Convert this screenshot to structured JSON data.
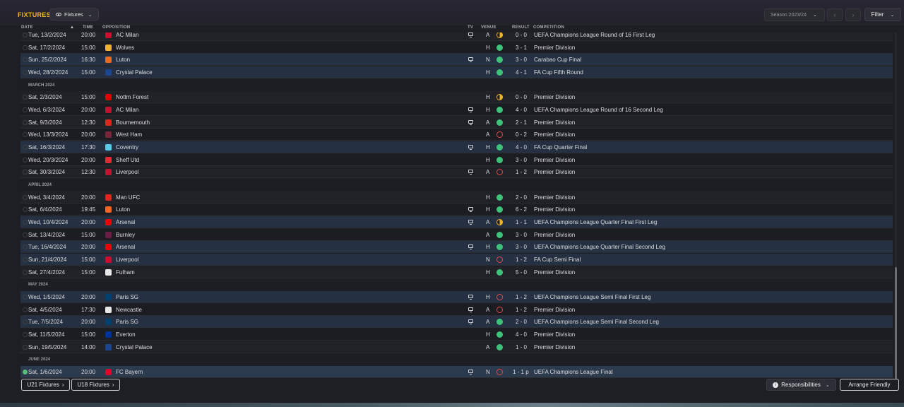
{
  "page": {
    "title": "FIXTURES",
    "view_label": "Fixtures",
    "season_label": "Season 2023/24",
    "filter_label": "Filter"
  },
  "columns": {
    "date": "DATE",
    "time": "TIME",
    "opposition": "OPPOSITION",
    "tv": "TV",
    "venue": "VENUE",
    "result": "RESULT",
    "competition": "COMPETITION"
  },
  "rows": [
    {
      "type": "fixture",
      "date": "Tue, 13/2/2024",
      "time": "20:00",
      "opp": "AC Milan",
      "tv": true,
      "venue": "A",
      "res": "d",
      "score": "0 - 0",
      "comp": "UEFA Champions League Round of 16 First Leg",
      "crest": "#c8102e",
      "hl": false
    },
    {
      "type": "fixture",
      "date": "Sat, 17/2/2024",
      "time": "15:00",
      "opp": "Wolves",
      "tv": false,
      "venue": "H",
      "res": "w",
      "score": "3 - 1",
      "comp": "Premier Division",
      "crest": "#f0b429",
      "hl": false
    },
    {
      "type": "fixture",
      "date": "Sun, 25/2/2024",
      "time": "16:30",
      "opp": "Luton",
      "tv": true,
      "venue": "N",
      "res": "w",
      "score": "3 - 0",
      "comp": "Carabao Cup Final",
      "crest": "#f26522",
      "hl": true
    },
    {
      "type": "fixture",
      "date": "Wed, 28/2/2024",
      "time": "15:00",
      "opp": "Crystal Palace",
      "tv": false,
      "venue": "H",
      "res": "w",
      "score": "4 - 1",
      "comp": "FA Cup Fifth Round",
      "crest": "#1b458f",
      "hl": true
    },
    {
      "type": "month",
      "label": "MARCH 2024"
    },
    {
      "type": "fixture",
      "date": "Sat, 2/3/2024",
      "time": "15:00",
      "opp": "Nottm Forest",
      "tv": false,
      "venue": "H",
      "res": "d",
      "score": "0 - 0",
      "comp": "Premier Division",
      "crest": "#dd0000",
      "hl": false
    },
    {
      "type": "fixture",
      "date": "Wed, 6/3/2024",
      "time": "20:00",
      "opp": "AC Milan",
      "tv": true,
      "venue": "H",
      "res": "w",
      "score": "4 - 0",
      "comp": "UEFA Champions League Round of 16 Second Leg",
      "crest": "#c8102e",
      "hl": false
    },
    {
      "type": "fixture",
      "date": "Sat, 9/3/2024",
      "time": "12:30",
      "opp": "Bournemouth",
      "tv": true,
      "venue": "A",
      "res": "w",
      "score": "2 - 1",
      "comp": "Premier Division",
      "crest": "#da291c",
      "hl": false
    },
    {
      "type": "fixture",
      "date": "Wed, 13/3/2024",
      "time": "20:00",
      "opp": "West Ham",
      "tv": false,
      "venue": "A",
      "res": "l",
      "score": "0 - 2",
      "comp": "Premier Division",
      "crest": "#7a263a",
      "hl": false
    },
    {
      "type": "fixture",
      "date": "Sat, 16/3/2024",
      "time": "17:30",
      "opp": "Coventry",
      "tv": true,
      "venue": "H",
      "res": "w",
      "score": "4 - 0",
      "comp": "FA Cup Quarter Final",
      "crest": "#59cbe8",
      "hl": true
    },
    {
      "type": "fixture",
      "date": "Wed, 20/3/2024",
      "time": "20:00",
      "opp": "Sheff Utd",
      "tv": false,
      "venue": "H",
      "res": "w",
      "score": "3 - 0",
      "comp": "Premier Division",
      "crest": "#ee2737",
      "hl": false
    },
    {
      "type": "fixture",
      "date": "Sat, 30/3/2024",
      "time": "12:30",
      "opp": "Liverpool",
      "tv": true,
      "venue": "A",
      "res": "l",
      "score": "1 - 2",
      "comp": "Premier Division",
      "crest": "#c8102e",
      "hl": false
    },
    {
      "type": "month",
      "label": "APRIL 2024"
    },
    {
      "type": "fixture",
      "date": "Wed, 3/4/2024",
      "time": "20:00",
      "opp": "Man UFC",
      "tv": false,
      "venue": "H",
      "res": "w",
      "score": "2 - 0",
      "comp": "Premier Division",
      "crest": "#da291c",
      "hl": false
    },
    {
      "type": "fixture",
      "date": "Sat, 6/4/2024",
      "time": "19:45",
      "opp": "Luton",
      "tv": true,
      "venue": "H",
      "res": "w",
      "score": "6 - 2",
      "comp": "Premier Division",
      "crest": "#f26522",
      "hl": false
    },
    {
      "type": "fixture",
      "date": "Wed, 10/4/2024",
      "time": "20:00",
      "opp": "Arsenal",
      "tv": true,
      "venue": "A",
      "res": "d",
      "score": "1 - 1",
      "comp": "UEFA Champions League Quarter Final First Leg",
      "crest": "#ef0107",
      "hl": true
    },
    {
      "type": "fixture",
      "date": "Sat, 13/4/2024",
      "time": "15:00",
      "opp": "Burnley",
      "tv": false,
      "venue": "A",
      "res": "w",
      "score": "3 - 0",
      "comp": "Premier Division",
      "crest": "#6c1d45",
      "hl": false
    },
    {
      "type": "fixture",
      "date": "Tue, 16/4/2024",
      "time": "20:00",
      "opp": "Arsenal",
      "tv": true,
      "venue": "H",
      "res": "w",
      "score": "3 - 0",
      "comp": "UEFA Champions League Quarter Final Second Leg",
      "crest": "#ef0107",
      "hl": true
    },
    {
      "type": "fixture",
      "date": "Sun, 21/4/2024",
      "time": "15:00",
      "opp": "Liverpool",
      "tv": false,
      "venue": "N",
      "res": "l",
      "score": "1 - 2",
      "comp": "FA Cup Semi Final",
      "crest": "#c8102e",
      "hl": true
    },
    {
      "type": "fixture",
      "date": "Sat, 27/4/2024",
      "time": "15:00",
      "opp": "Fulham",
      "tv": false,
      "venue": "H",
      "res": "w",
      "score": "5 - 0",
      "comp": "Premier Division",
      "crest": "#e8e8e8",
      "hl": false
    },
    {
      "type": "month",
      "label": "MAY 2024"
    },
    {
      "type": "fixture",
      "date": "Wed, 1/5/2024",
      "time": "20:00",
      "opp": "Paris SG",
      "tv": true,
      "venue": "H",
      "res": "l",
      "score": "1 - 2",
      "comp": "UEFA Champions League Semi Final First Leg",
      "crest": "#004170",
      "hl": true
    },
    {
      "type": "fixture",
      "date": "Sat, 4/5/2024",
      "time": "17:30",
      "opp": "Newcastle",
      "tv": true,
      "venue": "A",
      "res": "l",
      "score": "1 - 2",
      "comp": "Premier Division",
      "crest": "#e8e8e8",
      "hl": false
    },
    {
      "type": "fixture",
      "date": "Tue, 7/5/2024",
      "time": "20:00",
      "opp": "Paris SG",
      "tv": true,
      "venue": "A",
      "res": "w",
      "score": "2 - 0",
      "comp": "UEFA Champions League Semi Final Second Leg",
      "crest": "#004170",
      "hl": true
    },
    {
      "type": "fixture",
      "date": "Sat, 11/5/2024",
      "time": "15:00",
      "opp": "Everton",
      "tv": false,
      "venue": "H",
      "res": "w",
      "score": "4 - 0",
      "comp": "Premier Division",
      "crest": "#003399",
      "hl": false
    },
    {
      "type": "fixture",
      "date": "Sun, 19/5/2024",
      "time": "14:00",
      "opp": "Crystal Palace",
      "tv": false,
      "venue": "A",
      "res": "w",
      "score": "1 - 0",
      "comp": "Premier Division",
      "crest": "#1b458f",
      "hl": false
    },
    {
      "type": "month",
      "label": "JUNE 2024"
    },
    {
      "type": "fixture",
      "date": "Sat, 1/6/2024",
      "time": "20:00",
      "opp": "FC Bayern",
      "tv": true,
      "venue": "N",
      "res": "l",
      "score": "1 - 1 p",
      "comp": "UEFA Champions League Final",
      "crest": "#dc052d",
      "hl": true,
      "final": true
    }
  ],
  "bottom": {
    "u21": "U21 Fixtures",
    "u18": "U18 Fixtures",
    "responsibilities": "Responsibilities",
    "arrange": "Arrange Friendly"
  },
  "icons": {
    "chevron_right": "›",
    "chevron_left": "‹",
    "chevron_down": "⌄"
  }
}
